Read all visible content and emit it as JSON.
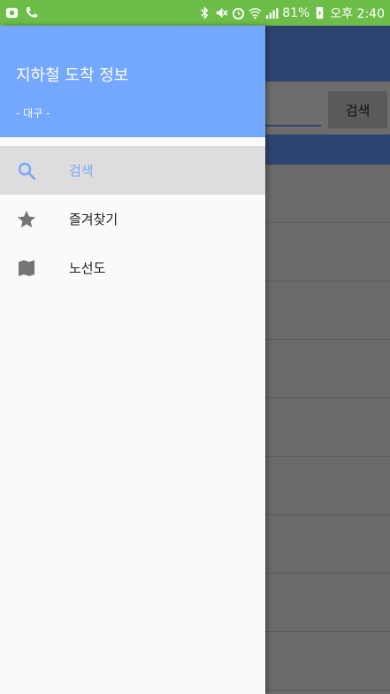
{
  "status_bar": {
    "battery": "81%",
    "time": "오후 2:40"
  },
  "background": {
    "search_button": "검색"
  },
  "drawer": {
    "title": "지하철 도착 정보",
    "subtitle": "- 대구 -",
    "items": [
      {
        "label": "검색",
        "icon": "search-icon",
        "active": true
      },
      {
        "label": "즐겨찾기",
        "icon": "star-icon",
        "active": false
      },
      {
        "label": "노선도",
        "icon": "map-icon",
        "active": false
      }
    ]
  },
  "colors": {
    "status_bar": "#6dbe48",
    "drawer_header": "#74a7fe",
    "app_bar": "#2e4470",
    "active_item_bg": "#dddddd"
  }
}
